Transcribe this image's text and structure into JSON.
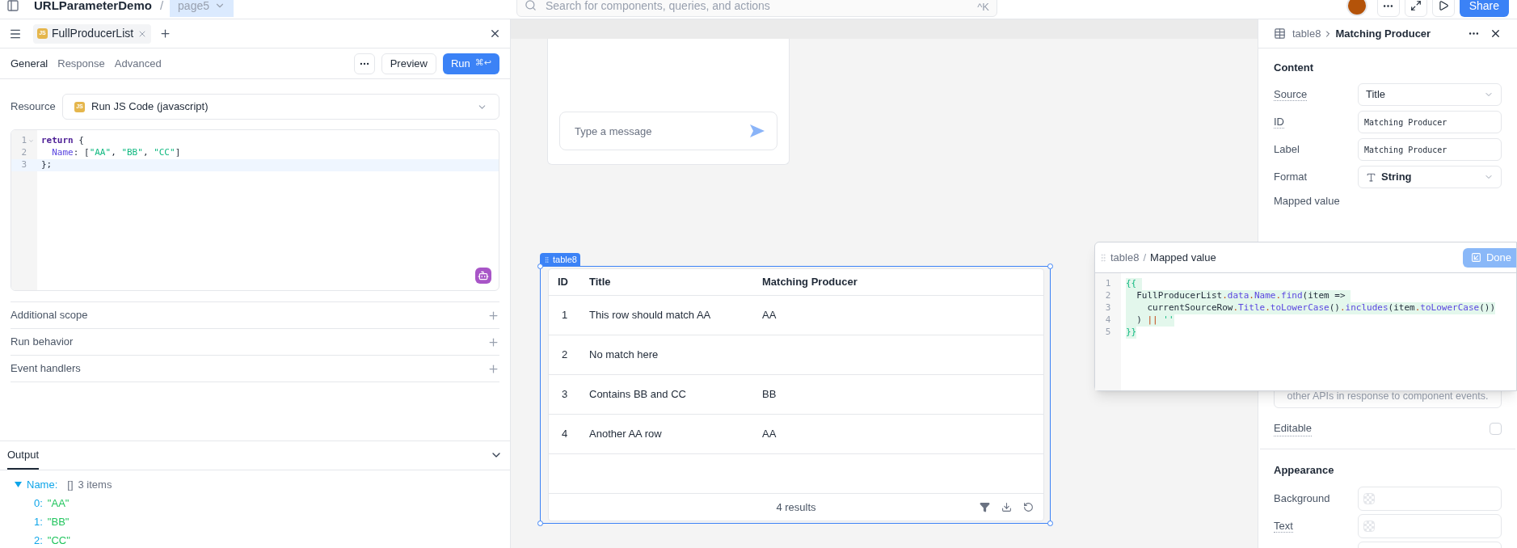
{
  "top_bar": {
    "app_name": "URLParameterDemo",
    "separator": "/",
    "page": "page5",
    "search": {
      "placeholder": "Search for components, queries, and actions",
      "shortcut": "^K"
    },
    "share": "Share"
  },
  "query_panel": {
    "tabs": [
      {
        "label": "FullProducerList",
        "badge": "JS",
        "selected": true
      }
    ],
    "subtabs": [
      {
        "label": "General",
        "selected": true
      },
      {
        "label": "Response",
        "selected": false
      },
      {
        "label": "Advanced",
        "selected": false
      }
    ],
    "preview": "Preview",
    "run": "Run",
    "run_shortcut": "⌘↩",
    "resource": {
      "label": "Resource",
      "badge": "JS",
      "value": "Run JS Code (javascript)"
    },
    "code": [
      {
        "number": "1",
        "foldable": true,
        "active": false,
        "tokens": [
          {
            "text": "return",
            "kind": "kw"
          },
          {
            "text": " {",
            "kind": "plain"
          }
        ]
      },
      {
        "number": "2",
        "foldable": false,
        "active": false,
        "tokens": [
          {
            "text": "  Name",
            "kind": "prop"
          },
          {
            "text": ": [",
            "kind": "plain"
          },
          {
            "text": "\"AA\"",
            "kind": "str"
          },
          {
            "text": ", ",
            "kind": "plain"
          },
          {
            "text": "\"BB\"",
            "kind": "str"
          },
          {
            "text": ", ",
            "kind": "plain"
          },
          {
            "text": "\"CC\"",
            "kind": "str"
          },
          {
            "text": "]",
            "kind": "plain"
          }
        ]
      },
      {
        "number": "3",
        "foldable": false,
        "active": true,
        "tokens": [
          {
            "text": "};",
            "kind": "plain"
          }
        ]
      }
    ],
    "sections": [
      {
        "label": "Additional scope",
        "expanded": false
      },
      {
        "label": "Run behavior",
        "expanded": false
      },
      {
        "label": "Event handlers",
        "expanded": false
      }
    ],
    "output": {
      "tab": "Output",
      "tree": [
        {
          "key": "Name:",
          "type": "[]",
          "summary": "3 items",
          "expanded": true,
          "children": [
            {
              "key": "0:",
              "value": "\"AA\""
            },
            {
              "key": "1:",
              "value": "\"BB\""
            },
            {
              "key": "2:",
              "value": "\"CC\""
            }
          ]
        }
      ]
    }
  },
  "canvas": {
    "chat": {
      "placeholder": "Type a message"
    },
    "table": {
      "name": "table8",
      "columns": [
        "ID",
        "Title",
        "Matching Producer"
      ],
      "rows": [
        [
          "1",
          "This row should match AA",
          "AA"
        ],
        [
          "2",
          "No match here",
          ""
        ],
        [
          "3",
          "Contains BB and CC",
          "BB"
        ],
        [
          "4",
          "Another AA row",
          "AA"
        ]
      ],
      "footer": "4 results"
    }
  },
  "inspector": {
    "breadcrumb": "table8",
    "title": "Matching Producer",
    "content_heading": "Content",
    "fields": [
      {
        "label": "Source",
        "kind": "select",
        "value": "Title",
        "tooltip": true
      },
      {
        "label": "ID",
        "kind": "input",
        "value": "Matching Producer",
        "tooltip": true
      },
      {
        "label": "Label",
        "kind": "input",
        "value": "Matching Producer",
        "tooltip": false
      },
      {
        "label": "Format",
        "kind": "type_select",
        "value": "String",
        "tooltip": false
      }
    ],
    "mapped_value_label": "Mapped value",
    "description": "other APIs in response to component events.",
    "editable": {
      "label": "Editable",
      "checked": false,
      "tooltip": true
    },
    "appearance_heading": "Appearance",
    "appearance_fields": [
      {
        "label": "Background",
        "tooltip": false
      },
      {
        "label": "Text",
        "tooltip": true
      }
    ]
  },
  "mapped_value_popup": {
    "breadcrumb": "table8",
    "separator": "/",
    "title": "Mapped value",
    "done": "Done",
    "code": [
      {
        "number": "1",
        "tokens": [
          {
            "text": "{{ ",
            "kind": "tpl"
          }
        ]
      },
      {
        "number": "2",
        "tokens": [
          {
            "text": "  FullProducerList",
            "kind": "plain"
          },
          {
            "text": ".",
            "kind": "punct"
          },
          {
            "text": "data",
            "kind": "prop"
          },
          {
            "text": ".",
            "kind": "punct"
          },
          {
            "text": "Name",
            "kind": "prop"
          },
          {
            "text": ".",
            "kind": "punct"
          },
          {
            "text": "find",
            "kind": "prop"
          },
          {
            "text": "(item => ",
            "kind": "plain"
          }
        ]
      },
      {
        "number": "3",
        "tokens": [
          {
            "text": "    currentSourceRow",
            "kind": "plain"
          },
          {
            "text": ".",
            "kind": "punct"
          },
          {
            "text": "Title",
            "kind": "prop"
          },
          {
            "text": ".",
            "kind": "punct"
          },
          {
            "text": "toLowerCase",
            "kind": "prop"
          },
          {
            "text": "()",
            "kind": "plain"
          },
          {
            "text": ".",
            "kind": "punct"
          },
          {
            "text": "includes",
            "kind": "prop"
          },
          {
            "text": "(item",
            "kind": "plain"
          },
          {
            "text": ".",
            "kind": "punct"
          },
          {
            "text": "toLowerCase",
            "kind": "prop"
          },
          {
            "text": "())",
            "kind": "plain"
          }
        ]
      },
      {
        "number": "4",
        "tokens": [
          {
            "text": "  ) ",
            "kind": "plain"
          },
          {
            "text": "||",
            "kind": "punct"
          },
          {
            "text": " ''",
            "kind": "str"
          }
        ]
      },
      {
        "number": "5",
        "tokens": [
          {
            "text": "}}",
            "kind": "tpl"
          }
        ]
      }
    ]
  }
}
